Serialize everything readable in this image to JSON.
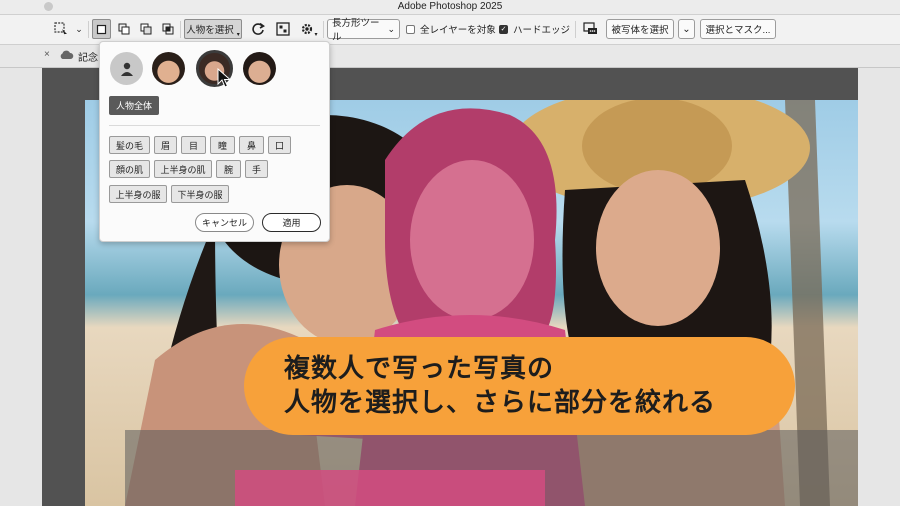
{
  "window": {
    "title": "Adobe Photoshop 2025"
  },
  "options_bar": {
    "select_subject_dropdown": "人物を選択",
    "tool_dropdown": "長方形ツール",
    "sample_all_layers": {
      "label": "全レイヤーを対象",
      "checked": false
    },
    "hard_edge": {
      "label": "ハードエッジ",
      "checked": true
    },
    "select_subject_button": "被写体を選択",
    "select_and_mask_button": "選択とマスク..."
  },
  "document_tab": {
    "name": "記念"
  },
  "people_panel": {
    "whole_person": "人物全体",
    "parts_rows": [
      [
        "髪の毛",
        "眉",
        "目",
        "瞳",
        "鼻",
        "口"
      ],
      [
        "顔の肌",
        "上半身の肌",
        "腕",
        "手"
      ],
      [
        "上半身の服",
        "下半身の服"
      ]
    ],
    "cancel_label": "キャンセル",
    "apply_label": "適用"
  },
  "banner": {
    "line1": "複数人で写った写真の",
    "line2": "人物を選択し、さらに部分を絞れる"
  },
  "colors": {
    "accent_orange": "#f7a13a",
    "selection_overlay": "#e0467f"
  }
}
